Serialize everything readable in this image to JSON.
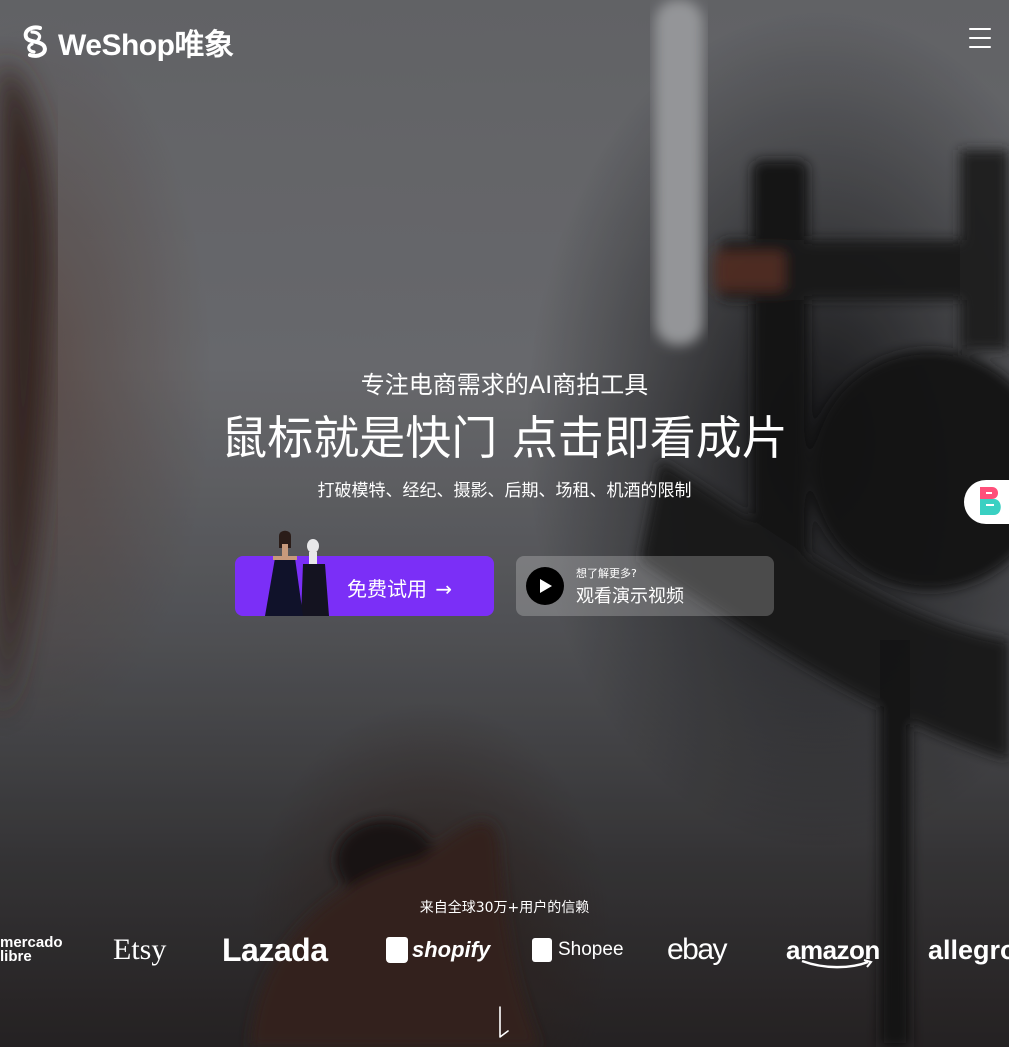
{
  "header": {
    "logo_text": "WeShop唯象",
    "menu_icon": "hamburger-menu-icon"
  },
  "hero": {
    "subtitle": "专注电商需求的AI商拍工具",
    "headline": "鼠标就是快门 点击即看成片",
    "tagline": "打破模特、经纪、摄影、后期、场租、机酒的限制"
  },
  "cta": {
    "primary_label": "免费试用",
    "primary_arrow": "→",
    "video_small": "想了解更多?",
    "video_label": "观看演示视频"
  },
  "trust": {
    "text": "来自全球30万+用户的信赖",
    "brands": {
      "mercado_line1": "mercado",
      "mercado_line2": "libre",
      "etsy": "Etsy",
      "lazada": "Lazada",
      "shopify": "shopify",
      "shopee": "Shopee",
      "ebay": "ebay",
      "amazon": "amazon",
      "allegro": "allegro"
    }
  },
  "colors": {
    "primary": "#7b2ff7",
    "text": "#ffffff",
    "video_button_bg": "rgba(255,255,255,0.22)"
  }
}
